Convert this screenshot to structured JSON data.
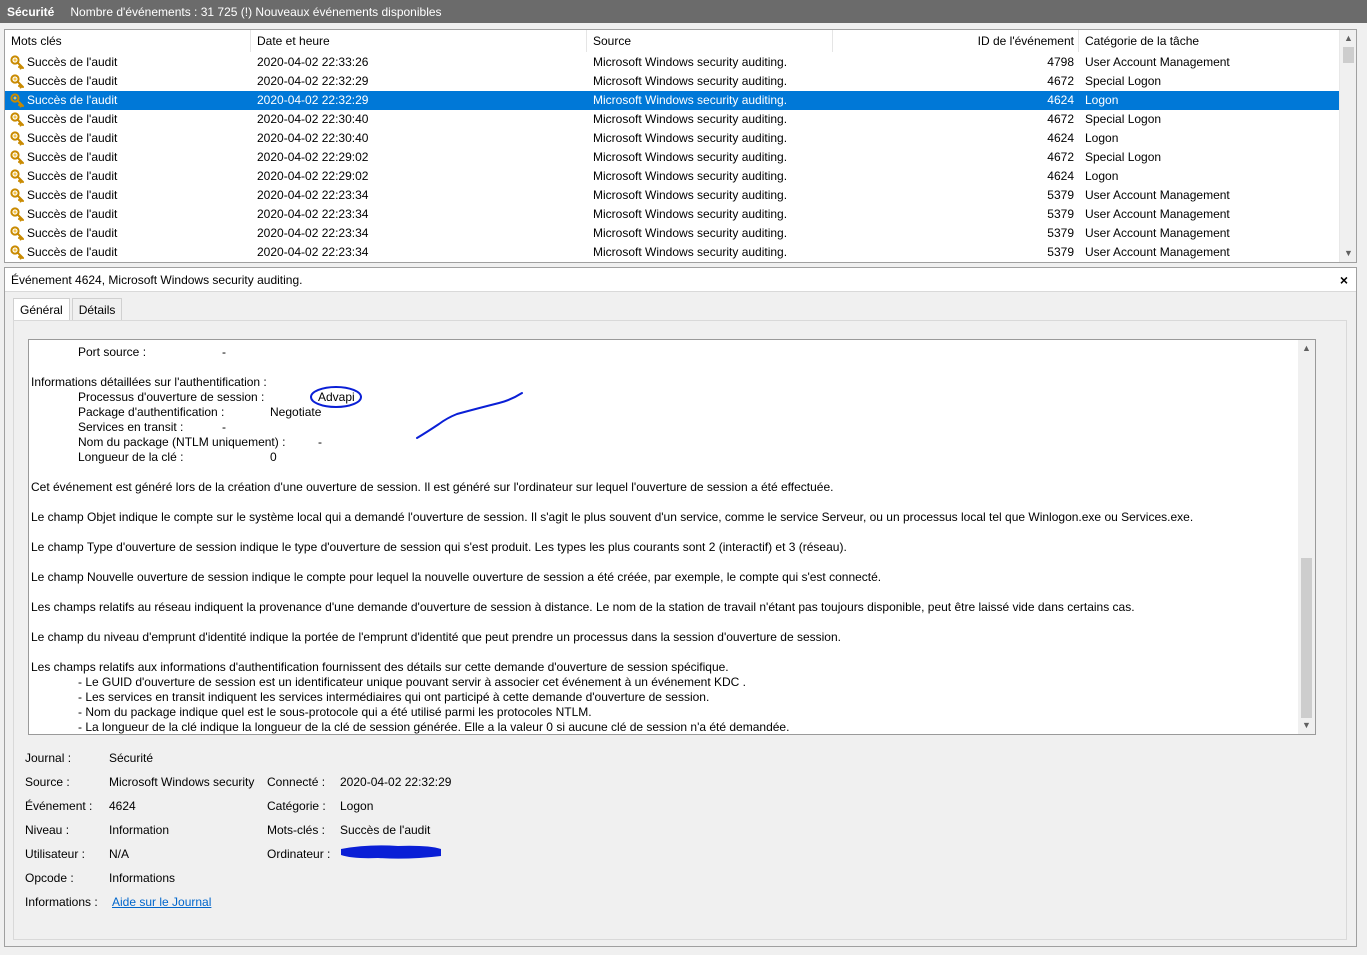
{
  "titlebar": {
    "name": "Sécurité",
    "info": "Nombre d'événements : 31 725 (!) Nouveaux événements disponibles"
  },
  "list": {
    "columns": [
      "Mots clés",
      "Date et heure",
      "Source",
      "ID de l'événement",
      "Catégorie de la tâche"
    ],
    "rows": [
      {
        "keyword": "Succès de l'audit",
        "date": "2020-04-02 22:33:26",
        "source": "Microsoft Windows security auditing.",
        "id": "4798",
        "category": "User Account Management"
      },
      {
        "keyword": "Succès de l'audit",
        "date": "2020-04-02 22:32:29",
        "source": "Microsoft Windows security auditing.",
        "id": "4672",
        "category": "Special Logon"
      },
      {
        "keyword": "Succès de l'audit",
        "date": "2020-04-02 22:32:29",
        "source": "Microsoft Windows security auditing.",
        "id": "4624",
        "category": "Logon",
        "selected": true
      },
      {
        "keyword": "Succès de l'audit",
        "date": "2020-04-02 22:30:40",
        "source": "Microsoft Windows security auditing.",
        "id": "4672",
        "category": "Special Logon"
      },
      {
        "keyword": "Succès de l'audit",
        "date": "2020-04-02 22:30:40",
        "source": "Microsoft Windows security auditing.",
        "id": "4624",
        "category": "Logon"
      },
      {
        "keyword": "Succès de l'audit",
        "date": "2020-04-02 22:29:02",
        "source": "Microsoft Windows security auditing.",
        "id": "4672",
        "category": "Special Logon"
      },
      {
        "keyword": "Succès de l'audit",
        "date": "2020-04-02 22:29:02",
        "source": "Microsoft Windows security auditing.",
        "id": "4624",
        "category": "Logon"
      },
      {
        "keyword": "Succès de l'audit",
        "date": "2020-04-02 22:23:34",
        "source": "Microsoft Windows security auditing.",
        "id": "5379",
        "category": "User Account Management"
      },
      {
        "keyword": "Succès de l'audit",
        "date": "2020-04-02 22:23:34",
        "source": "Microsoft Windows security auditing.",
        "id": "5379",
        "category": "User Account Management"
      },
      {
        "keyword": "Succès de l'audit",
        "date": "2020-04-02 22:23:34",
        "source": "Microsoft Windows security auditing.",
        "id": "5379",
        "category": "User Account Management"
      },
      {
        "keyword": "Succès de l'audit",
        "date": "2020-04-02 22:23:34",
        "source": "Microsoft Windows security auditing.",
        "id": "5379",
        "category": "User Account Management"
      }
    ]
  },
  "detail": {
    "title": "Événement 4624, Microsoft Windows security auditing.",
    "close": "×",
    "tabs": [
      "Général",
      "Détails"
    ],
    "text": {
      "port_source_label": "Port source :",
      "port_source_value": "-",
      "auth_heading": "Informations détaillées sur l'authentification :",
      "logon_process_label": "Processus d'ouverture de session :",
      "logon_process_value": "Advapi",
      "auth_package_label": "Package d'authentification :",
      "auth_package_value": "Negotiate",
      "transited_label": "Services en transit :",
      "transited_value": "-",
      "ntlm_label": "Nom du package (NTLM uniquement) :",
      "ntlm_value": "-",
      "keylen_label": "Longueur de la clé :",
      "keylen_value": "0",
      "p1": "Cet événement est généré lors de la création d'une ouverture de session. Il est généré sur l'ordinateur sur lequel l'ouverture de session a été effectuée.",
      "p2": "Le champ Objet indique le compte sur le système local qui a demandé l'ouverture de session. Il s'agit le plus souvent d'un service, comme le service Serveur, ou un processus local tel que Winlogon.exe ou Services.exe.",
      "p3": "Le champ Type d'ouverture de session indique le type d'ouverture de session qui s'est produit. Les types les plus courants sont 2 (interactif) et 3 (réseau).",
      "p4": "Le champ Nouvelle ouverture de session indique le compte pour lequel la nouvelle ouverture de session a été créée, par exemple, le compte qui s'est connecté.",
      "p5": "Les champs relatifs au réseau indiquent la provenance d'une demande d'ouverture de session à distance. Le nom de la station de travail n'étant pas toujours disponible, peut être laissé vide dans certains cas.",
      "p6": "Le champ du niveau d'emprunt d'identité indique la portée de l'emprunt d'identité que peut prendre un processus dans la session d'ouverture de session.",
      "p7": "Les champs relatifs aux informations d'authentification fournissent des détails sur cette demande d'ouverture de session spécifique.",
      "b1": "- Le GUID d'ouverture de session est un identificateur unique pouvant servir à associer cet événement à un événement KDC .",
      "b2": "- Les services en transit indiquent les services intermédiaires qui ont participé à cette demande d'ouverture de session.",
      "b3": "- Nom du package indique quel est le sous-protocole qui a été utilisé parmi les protocoles NTLM.",
      "b4": "- La longueur de la clé indique la longueur de la clé de session générée. Elle a la valeur 0 si aucune clé de session n'a été demandée."
    },
    "props": {
      "journal_label": "Journal :",
      "journal_value": "Sécurité",
      "source_label": "Source :",
      "source_value": "Microsoft Windows security",
      "connected_label": "Connecté :",
      "connected_value": "2020-04-02 22:32:29",
      "event_label": "Événement :",
      "event_value": "4624",
      "category_label": "Catégorie :",
      "category_value": "Logon",
      "level_label": "Niveau :",
      "level_value": "Information",
      "keywords_label": "Mots-clés :",
      "keywords_value": "Succès de l'audit",
      "user_label": "Utilisateur :",
      "user_value": "N/A",
      "computer_label": "Ordinateur :",
      "opcode_label": "Opcode :",
      "opcode_value": "Informations",
      "info_label": "Informations :",
      "info_link": "Aide sur le Journal"
    }
  },
  "colors": {
    "titlebar": "#6b6b6b",
    "selection": "#0078d7",
    "link": "#0066cc",
    "ink": "#0a1fd6"
  }
}
